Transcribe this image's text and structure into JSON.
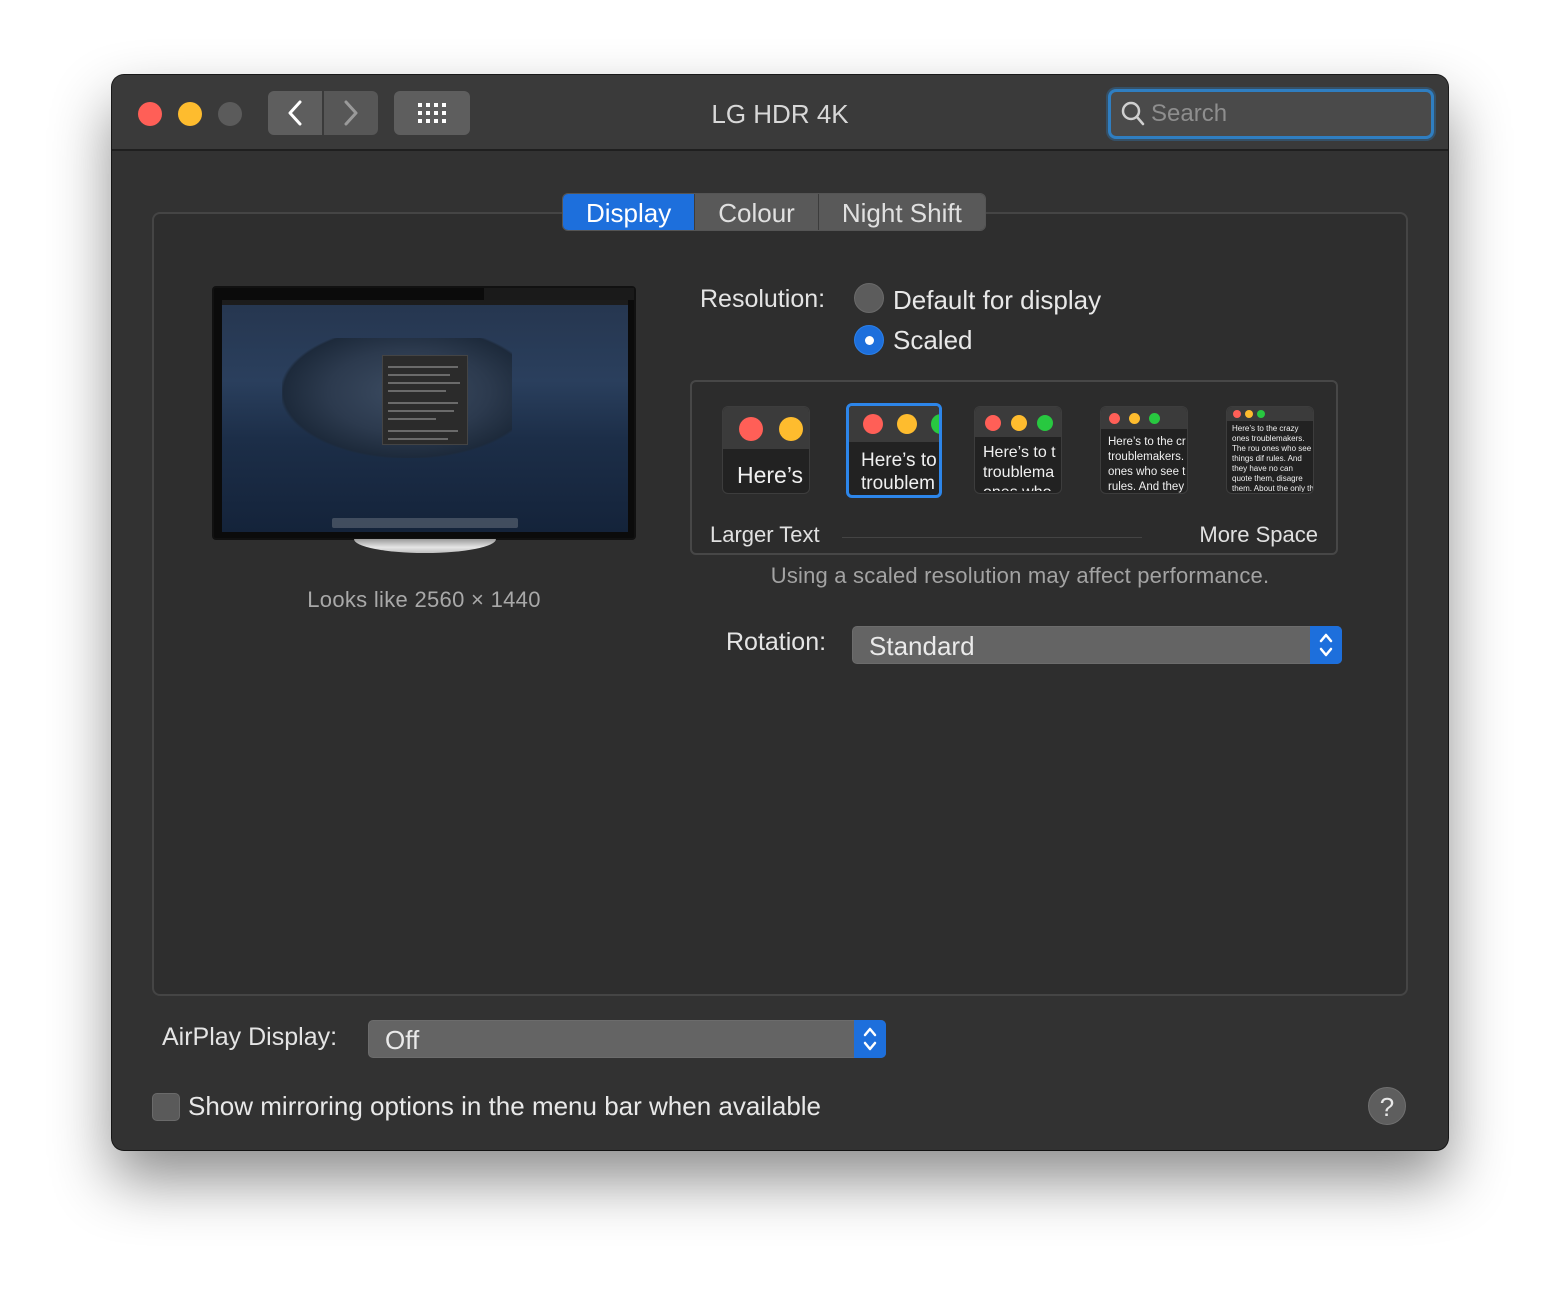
{
  "window": {
    "title": "LG HDR 4K",
    "search_placeholder": "Search"
  },
  "tabs": [
    {
      "label": "Display",
      "active": true
    },
    {
      "label": "Colour",
      "active": false
    },
    {
      "label": "Night Shift",
      "active": false
    }
  ],
  "display": {
    "looks_like": "Looks like 2560 × 1440",
    "resolution_label": "Resolution:",
    "resolution_options": [
      {
        "label": "Default for display",
        "selected": false
      },
      {
        "label": "Scaled",
        "selected": true
      }
    ],
    "scale_options": [
      {
        "text": "Here’s",
        "selected": false
      },
      {
        "text": "Here’s to troublem",
        "selected": true
      },
      {
        "text": "Here’s to t troublema ones who",
        "selected": false
      },
      {
        "text": "Here’s to the cr troublemakers. ones who see t rules. And they",
        "selected": false
      },
      {
        "text": "Here’s to the crazy ones troublemakers. The rou ones who see things dif rules. And they have no can quote them, disagre them. About the only th Because they change th",
        "selected": false
      }
    ],
    "larger_text_label": "Larger Text",
    "more_space_label": "More Space",
    "performance_note": "Using a scaled resolution may affect performance.",
    "rotation_label": "Rotation:",
    "rotation_value": "Standard"
  },
  "footer": {
    "airplay_label": "AirPlay Display:",
    "airplay_value": "Off",
    "mirroring_label": "Show mirroring options in the menu bar when available",
    "mirroring_checked": false,
    "help_label": "?"
  },
  "colors": {
    "accent": "#1d6fdc",
    "close": "#ff5f57",
    "minimize": "#febc2e",
    "maximize_disabled": "#5b5b5b"
  }
}
